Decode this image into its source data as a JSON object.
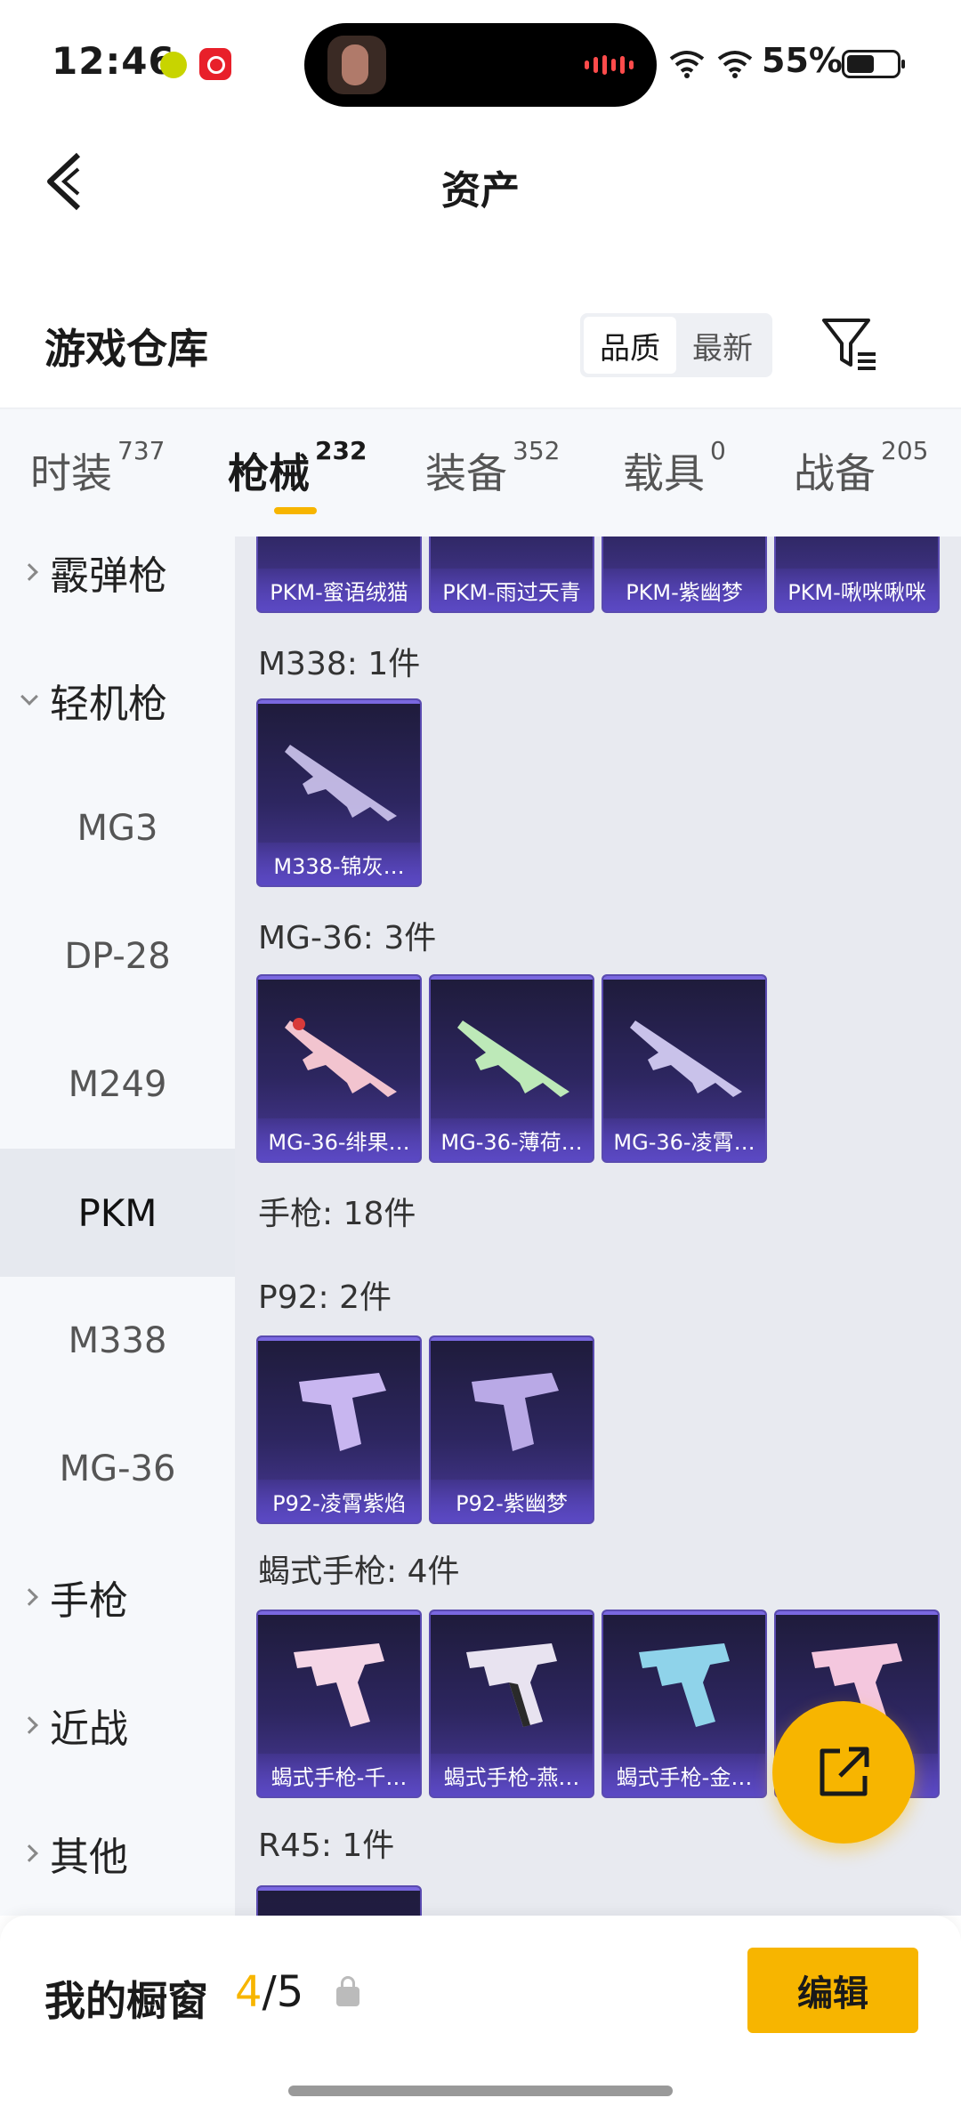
{
  "status_bar": {
    "time": "12:46",
    "battery": "55%"
  },
  "header": {
    "title": "资产"
  },
  "warehouse": {
    "title": "游戏仓库",
    "sort_options": [
      "品质",
      "最新"
    ]
  },
  "tabs": [
    {
      "label": "时装",
      "count": "737"
    },
    {
      "label": "枪械",
      "count": "232"
    },
    {
      "label": "装备",
      "count": "352"
    },
    {
      "label": "载具",
      "count": "0"
    },
    {
      "label": "战备",
      "count": "205"
    }
  ],
  "sidebar": [
    {
      "label": "霰弹枪",
      "kind": "cat"
    },
    {
      "label": "轻机枪",
      "kind": "cat-open"
    },
    {
      "label": "MG3",
      "kind": "sub"
    },
    {
      "label": "DP-28",
      "kind": "sub"
    },
    {
      "label": "M249",
      "kind": "sub"
    },
    {
      "label": "PKM",
      "kind": "sub-selected"
    },
    {
      "label": "M338",
      "kind": "sub"
    },
    {
      "label": "MG-36",
      "kind": "sub"
    },
    {
      "label": "手枪",
      "kind": "cat"
    },
    {
      "label": "近战",
      "kind": "cat"
    },
    {
      "label": "其他",
      "kind": "cat"
    }
  ],
  "groups": {
    "pkm_cards": [
      "PKM-蜜语绒猫",
      "PKM-雨过天青",
      "PKM-紫幽梦",
      "PKM-啾咪啾咪"
    ],
    "m338_label": "M338: 1件",
    "m338_cards": [
      "M338-锦灰…"
    ],
    "mg36_label": "MG-36: 3件",
    "mg36_cards": [
      "MG-36-绯果…",
      "MG-36-薄荷…",
      "MG-36-凌霄…"
    ],
    "pistol_label": "手枪: 18件",
    "p92_label": "P92: 2件",
    "p92_cards": [
      "P92-凌霄紫焰",
      "P92-紫幽梦"
    ],
    "scorpion_label": "蝎式手枪: 4件",
    "scorpion_cards": [
      "蝎式手枪-千…",
      "蝎式手枪-燕…",
      "蝎式手枪-金…",
      ""
    ],
    "r45_label": "R45: 1件"
  },
  "bottom": {
    "showcase_label": "我的橱窗",
    "showcase_current": "4",
    "showcase_total": "/5",
    "edit_label": "编辑"
  },
  "colors": {
    "accent": "#f7b500",
    "card_purple": "#5b49c4"
  }
}
